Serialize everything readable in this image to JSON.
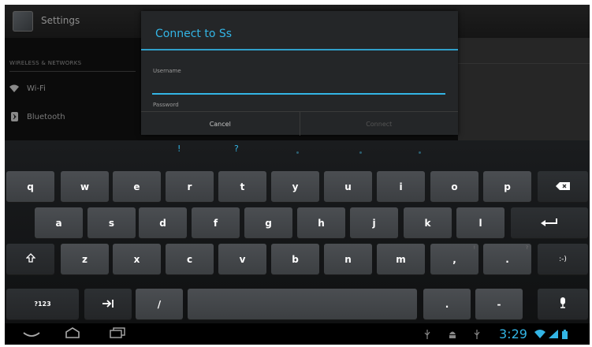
{
  "settings": {
    "title": "Settings",
    "section_header": "WIRELESS & NETWORKS",
    "items": [
      {
        "label": "Wi-Fi",
        "icon": "wifi-icon"
      },
      {
        "label": "Bluetooth",
        "icon": "bluetooth-icon"
      }
    ]
  },
  "dialog": {
    "title": "Connect to Ss",
    "username_label": "Username",
    "username_value": "",
    "password_label": "Password",
    "cancel_label": "Cancel",
    "connect_label": "Connect"
  },
  "keyboard": {
    "suggestions": [
      "!",
      "?"
    ],
    "row1": [
      "q",
      "w",
      "e",
      "r",
      "t",
      "y",
      "u",
      "i",
      "o",
      "p"
    ],
    "row2": [
      "a",
      "s",
      "d",
      "f",
      "g",
      "h",
      "j",
      "k",
      "l"
    ],
    "row3": [
      "z",
      "x",
      "c",
      "v",
      "b",
      "n",
      "m",
      ",",
      "."
    ],
    "row3_hints": [
      "",
      "",
      "",
      "",
      "",
      "",
      "",
      "!",
      "?"
    ],
    "symbols_key": "?123",
    "slash_key": "/",
    "period_key": ".",
    "dash_key": "-",
    "smiley_key": ":-)",
    "icons": {
      "backspace": "backspace-icon",
      "enter": "enter-icon",
      "shift": "shift-icon",
      "tab": "tab-icon",
      "mic": "microphone-icon"
    }
  },
  "status_bar": {
    "time": "3:29",
    "accent_color": "#33b5e5"
  }
}
